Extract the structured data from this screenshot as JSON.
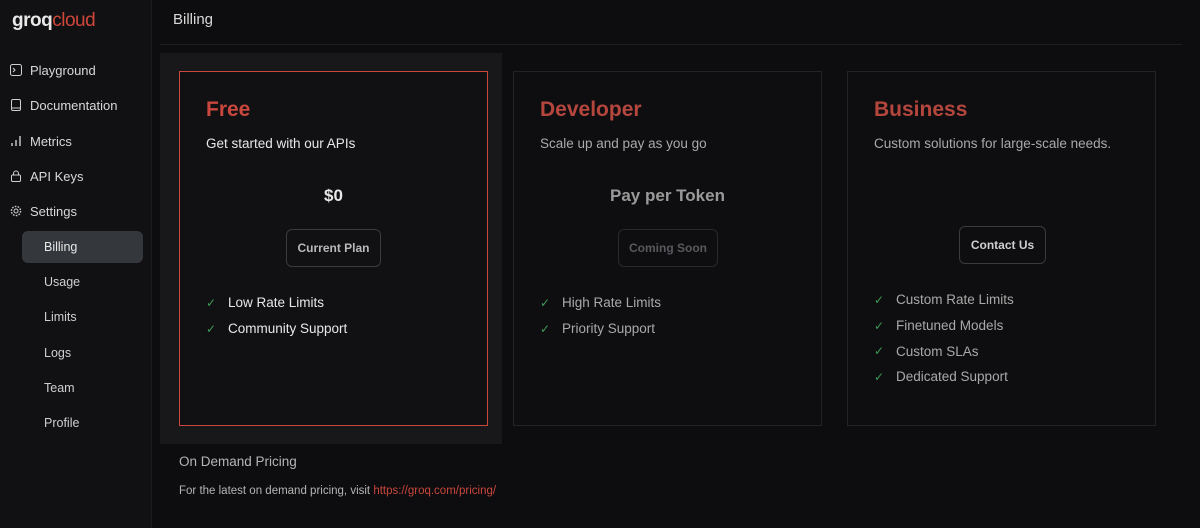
{
  "brand": {
    "part1": "groq",
    "part2": "cloud",
    "accent": "#c9473d"
  },
  "sidebar": {
    "items": [
      {
        "label": "Playground",
        "icon": "terminal-icon"
      },
      {
        "label": "Documentation",
        "icon": "book-icon"
      },
      {
        "label": "Metrics",
        "icon": "bar-chart-icon"
      },
      {
        "label": "API Keys",
        "icon": "lock-icon"
      },
      {
        "label": "Settings",
        "icon": "gear-icon"
      }
    ],
    "settings_items": [
      "Billing",
      "Usage",
      "Limits",
      "Logs",
      "Team",
      "Profile"
    ],
    "active_item": "Billing"
  },
  "header": {
    "title": "Billing"
  },
  "plans": [
    {
      "name": "Free",
      "description": "Get started with our APIs",
      "price": "$0",
      "button": "Current Plan",
      "features": [
        "Low Rate Limits",
        "Community Support"
      ]
    },
    {
      "name": "Developer",
      "description": "Scale up and pay as you go",
      "price": "Pay per Token",
      "button": "Coming Soon",
      "features": [
        "High Rate Limits",
        "Priority Support"
      ]
    },
    {
      "name": "Business",
      "description": "Custom solutions for large-scale needs.",
      "price": "",
      "button": "Contact Us",
      "features": [
        "Custom Rate Limits",
        "Finetuned Models",
        "Custom SLAs",
        "Dedicated Support"
      ]
    }
  ],
  "on_demand": {
    "title": "On Demand Pricing",
    "text": "For the latest on demand pricing, visit ",
    "link": "https://groq.com/pricing/"
  }
}
